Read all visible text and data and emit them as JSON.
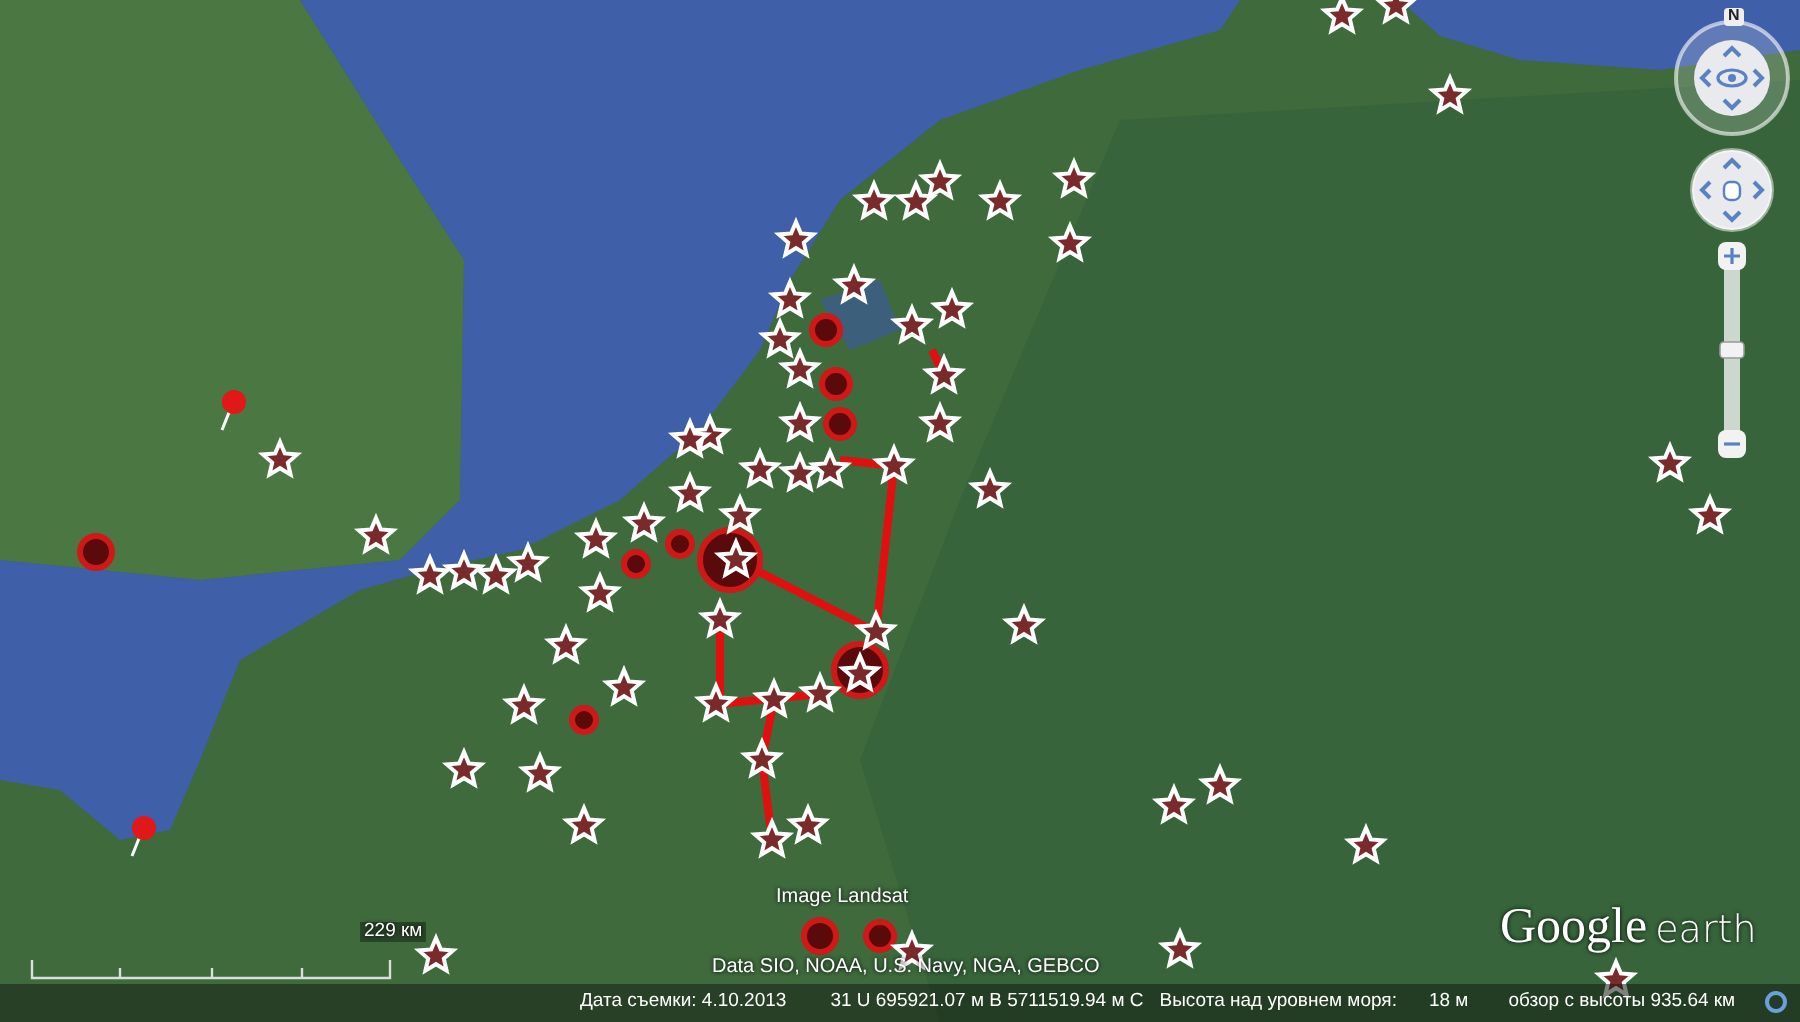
{
  "map": {
    "attributions": [
      {
        "text": "Image Landsat"
      },
      {
        "text": "Data SIO, NOAA, U.S. Navy, NGA, GEBCO"
      }
    ],
    "scale_label": "229 км",
    "logo": {
      "word_1": "Google",
      "word_2": "earth"
    }
  },
  "navigation": {
    "compass_label": "N",
    "zoom_slider": {
      "level": 0.5
    }
  },
  "status_bar": {
    "date": "Дата съемки: 4.10.2013",
    "coordinates": "31 U 695921.07 м В 5711519.94 м С",
    "elevation_label": "Высота над уровнем моря:",
    "elevation": "18 м",
    "eye_altitude": "обзор с высоты 935.64 км"
  }
}
